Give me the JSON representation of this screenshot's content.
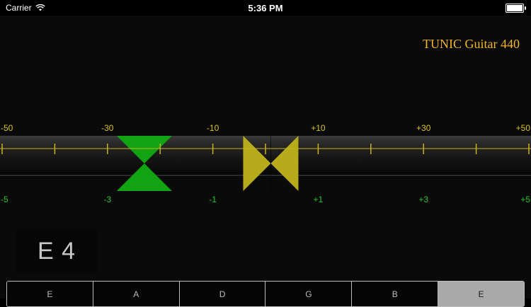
{
  "status_bar": {
    "carrier": "Carrier",
    "time": "5:36 PM"
  },
  "brand": "TUNIC Guitar 440",
  "meter": {
    "cents_labels": [
      "-50",
      "-30",
      "-10",
      "+10",
      "+30",
      "+50"
    ],
    "fine_labels": [
      "-5",
      "-3",
      "-1",
      "+1",
      "+3",
      "+5"
    ],
    "ref_marker_value": -2.3,
    "needle_value": 0.1,
    "colors": {
      "ref_marker": "#11a311",
      "needle": "#b6ab1a",
      "cents_text": "#d8c21a",
      "fine_text": "#27c627",
      "tick": "#c8b41c"
    }
  },
  "note": "E 4",
  "strings": {
    "labels": [
      "E",
      "A",
      "D",
      "G",
      "B",
      "E"
    ],
    "selected_index": 5
  }
}
